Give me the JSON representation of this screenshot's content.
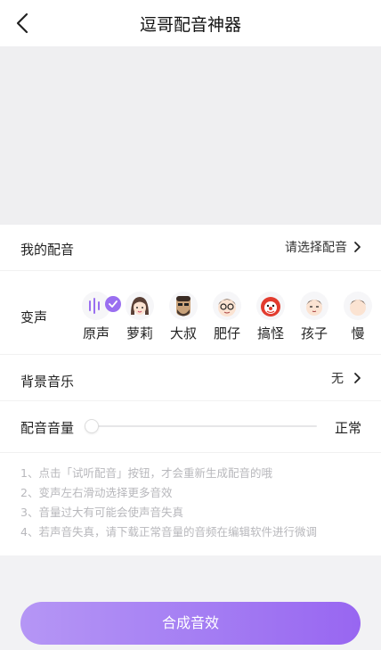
{
  "header": {
    "title": "逗哥配音神器",
    "back_icon": "back-arrow-icon"
  },
  "dubbing": {
    "label": "我的配音",
    "value": "请选择配音"
  },
  "voice_change": {
    "label": "变声",
    "selected": "原声",
    "items": [
      {
        "name": "原声",
        "icon": "soundwave-icon"
      },
      {
        "name": "萝莉",
        "icon": "girl-avatar-icon"
      },
      {
        "name": "大叔",
        "icon": "uncle-avatar-icon"
      },
      {
        "name": "肥仔",
        "icon": "fat-kid-avatar-icon"
      },
      {
        "name": "搞怪",
        "icon": "clown-avatar-icon"
      },
      {
        "name": "孩子",
        "icon": "child-avatar-icon"
      },
      {
        "name": "慢",
        "icon": "slow-avatar-icon"
      }
    ]
  },
  "background_music": {
    "label": "背景音乐",
    "value": "无"
  },
  "volume": {
    "label": "配音音量",
    "value": "正常",
    "level": 0
  },
  "tips": [
    "1、点击「试听配音」按钮，才会重新生成配音的哦",
    "2、变声左右滑动选择更多音效",
    "3、音量过大有可能会使声音失真",
    "4、若声音失真，请下载正常音量的音频在编辑软件进行微调"
  ],
  "primary_button": "合成音效",
  "colors": {
    "accent": "#9a6ff0",
    "button_start": "#b596f5",
    "button_end": "#9866f1"
  }
}
